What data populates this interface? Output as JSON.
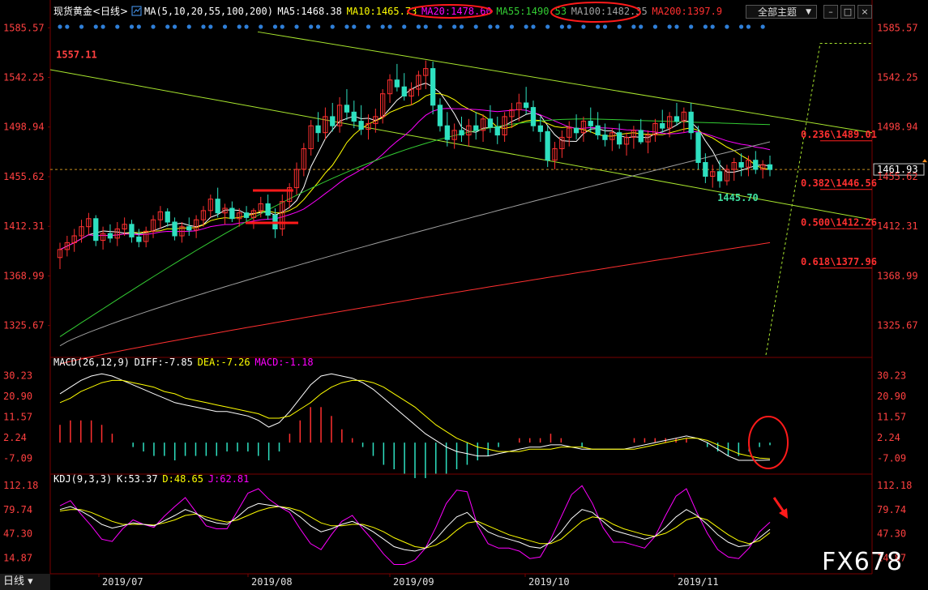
{
  "window": {
    "theme_button_label": "全部主题",
    "period_tab": "日线",
    "watermark": "FX678"
  },
  "price_panel": {
    "header": {
      "name": "现货黄金<日线>",
      "params": "MA(5,10,20,55,100,200)",
      "items": [
        {
          "text": "MA5:1468.38",
          "color": "#ffffff"
        },
        {
          "text": "MA10:1465.73",
          "color": "#ffff00"
        },
        {
          "text": "MA20:1478.60",
          "color": "#ff00ff"
        },
        {
          "text": "MA55:1490.53",
          "color": "#33cc33"
        },
        {
          "text": "MA100:1482.35",
          "color": "#a0a0a0"
        },
        {
          "text": "MA200:1397.9",
          "color": "#ff3030"
        }
      ]
    },
    "y_ticks": [
      "1585.57",
      "1542.25",
      "1498.94",
      "1455.62",
      "1412.31",
      "1368.99",
      "1325.67"
    ],
    "last_price": "1461.93",
    "high_label": "1557.11",
    "low_label": "1445.70",
    "fib_labels": [
      {
        "text": "0.236\\1489.01",
        "value": 1489.01
      },
      {
        "text": "0.382\\1446.56",
        "value": 1446.56
      },
      {
        "text": "0.500\\1412.26",
        "value": 1412.26
      },
      {
        "text": "0.618\\1377.96",
        "value": 1377.96
      }
    ]
  },
  "macd_panel": {
    "header": {
      "name": "MACD(26,12,9)",
      "items": [
        {
          "text": "DIFF:-7.85",
          "color": "#ffffff"
        },
        {
          "text": "DEA:-7.26",
          "color": "#ffff00"
        },
        {
          "text": "MACD:-1.18",
          "color": "#ff00ff"
        }
      ]
    },
    "y_ticks": [
      "30.23",
      "20.90",
      "11.57",
      "2.24",
      "-7.09"
    ]
  },
  "kdj_panel": {
    "header": {
      "name": "KDJ(9,3,3)",
      "items": [
        {
          "text": "K:53.37",
          "color": "#ffffff"
        },
        {
          "text": "D:48.65",
          "color": "#ffff00"
        },
        {
          "text": "J:62.81",
          "color": "#ff00ff"
        }
      ]
    },
    "y_ticks": [
      "112.18",
      "79.74",
      "47.30",
      "14.87"
    ]
  },
  "x_axis": {
    "labels": [
      "2019/07",
      "2019/08",
      "2019/09",
      "2019/10",
      "2019/11"
    ]
  },
  "colors": {
    "up": "#ff3030",
    "down": "#2ee0c0",
    "axis_text": "#ff4040",
    "grid": "#7a0000",
    "annotation": "#ff2020"
  },
  "chart_data": [
    {
      "type": "candlestick",
      "title": "现货黄金<日线>",
      "y_range": [
        1300,
        1590
      ],
      "x_labels": [
        "2019/07",
        "2019/08",
        "2019/09",
        "2019/10",
        "2019/11"
      ],
      "annotations": {
        "high": 1557.11,
        "low": 1445.7,
        "last": 1461.93
      },
      "ohlc": [
        [
          1385,
          1398,
          1375,
          1392
        ],
        [
          1392,
          1404,
          1386,
          1398
        ],
        [
          1398,
          1410,
          1390,
          1404
        ],
        [
          1404,
          1418,
          1398,
          1412
        ],
        [
          1412,
          1424,
          1405,
          1419
        ],
        [
          1419,
          1422,
          1395,
          1400
        ],
        [
          1400,
          1412,
          1392,
          1406
        ],
        [
          1406,
          1414,
          1398,
          1402
        ],
        [
          1402,
          1416,
          1395,
          1410
        ],
        [
          1410,
          1420,
          1404,
          1414
        ],
        [
          1414,
          1418,
          1398,
          1403
        ],
        [
          1403,
          1410,
          1394,
          1399
        ],
        [
          1399,
          1412,
          1394,
          1408
        ],
        [
          1408,
          1422,
          1402,
          1418
        ],
        [
          1418,
          1430,
          1410,
          1425
        ],
        [
          1425,
          1428,
          1412,
          1416
        ],
        [
          1416,
          1420,
          1400,
          1404
        ],
        [
          1404,
          1416,
          1398,
          1412
        ],
        [
          1412,
          1420,
          1404,
          1409
        ],
        [
          1409,
          1422,
          1402,
          1418
        ],
        [
          1418,
          1430,
          1412,
          1426
        ],
        [
          1426,
          1440,
          1420,
          1436
        ],
        [
          1436,
          1446,
          1420,
          1424
        ],
        [
          1424,
          1432,
          1414,
          1428
        ],
        [
          1428,
          1434,
          1416,
          1419
        ],
        [
          1419,
          1428,
          1412,
          1424
        ],
        [
          1424,
          1430,
          1416,
          1420
        ],
        [
          1420,
          1428,
          1410,
          1426
        ],
        [
          1426,
          1438,
          1420,
          1432
        ],
        [
          1432,
          1440,
          1418,
          1422
        ],
        [
          1422,
          1428,
          1402,
          1410
        ],
        [
          1410,
          1440,
          1404,
          1434
        ],
        [
          1434,
          1450,
          1428,
          1446
        ],
        [
          1446,
          1468,
          1440,
          1462
        ],
        [
          1462,
          1485,
          1456,
          1480
        ],
        [
          1480,
          1505,
          1474,
          1500
        ],
        [
          1500,
          1512,
          1486,
          1494
        ],
        [
          1494,
          1516,
          1488,
          1508
        ],
        [
          1508,
          1520,
          1495,
          1500
        ],
        [
          1500,
          1525,
          1494,
          1518
        ],
        [
          1518,
          1532,
          1505,
          1512
        ],
        [
          1512,
          1522,
          1498,
          1504
        ],
        [
          1504,
          1518,
          1492,
          1497
        ],
        [
          1497,
          1510,
          1488,
          1502
        ],
        [
          1502,
          1515,
          1494,
          1508
        ],
        [
          1508,
          1532,
          1502,
          1528
        ],
        [
          1528,
          1545,
          1520,
          1540
        ],
        [
          1540,
          1554,
          1530,
          1534
        ],
        [
          1534,
          1546,
          1522,
          1526
        ],
        [
          1526,
          1538,
          1518,
          1532
        ],
        [
          1532,
          1548,
          1526,
          1544
        ],
        [
          1544,
          1557,
          1532,
          1550
        ],
        [
          1550,
          1556,
          1510,
          1518
        ],
        [
          1518,
          1524,
          1495,
          1500
        ],
        [
          1500,
          1512,
          1482,
          1488
        ],
        [
          1488,
          1502,
          1480,
          1496
        ],
        [
          1496,
          1508,
          1486,
          1492
        ],
        [
          1492,
          1506,
          1482,
          1500
        ],
        [
          1500,
          1512,
          1488,
          1496
        ],
        [
          1496,
          1510,
          1486,
          1506
        ],
        [
          1506,
          1518,
          1494,
          1499
        ],
        [
          1499,
          1508,
          1484,
          1492
        ],
        [
          1492,
          1512,
          1486,
          1508
        ],
        [
          1508,
          1520,
          1498,
          1514
        ],
        [
          1514,
          1528,
          1504,
          1520
        ],
        [
          1520,
          1534,
          1510,
          1516
        ],
        [
          1516,
          1522,
          1495,
          1500
        ],
        [
          1500,
          1508,
          1486,
          1495
        ],
        [
          1495,
          1500,
          1464,
          1470
        ],
        [
          1470,
          1486,
          1462,
          1480
        ],
        [
          1480,
          1496,
          1472,
          1490
        ],
        [
          1490,
          1504,
          1482,
          1498
        ],
        [
          1498,
          1510,
          1488,
          1494
        ],
        [
          1494,
          1508,
          1486,
          1504
        ],
        [
          1504,
          1516,
          1494,
          1500
        ],
        [
          1500,
          1512,
          1488,
          1492
        ],
        [
          1492,
          1502,
          1482,
          1488
        ],
        [
          1488,
          1498,
          1478,
          1494
        ],
        [
          1494,
          1502,
          1480,
          1484
        ],
        [
          1484,
          1494,
          1474,
          1490
        ],
        [
          1490,
          1500,
          1480,
          1496
        ],
        [
          1496,
          1506,
          1484,
          1486
        ],
        [
          1486,
          1496,
          1476,
          1492
        ],
        [
          1492,
          1506,
          1486,
          1502
        ],
        [
          1502,
          1514,
          1494,
          1498
        ],
        [
          1498,
          1512,
          1490,
          1508
        ],
        [
          1508,
          1520,
          1500,
          1504
        ],
        [
          1504,
          1516,
          1494,
          1512
        ],
        [
          1512,
          1520,
          1488,
          1494
        ],
        [
          1494,
          1500,
          1462,
          1468
        ],
        [
          1468,
          1476,
          1450,
          1456
        ],
        [
          1456,
          1466,
          1446,
          1460
        ],
        [
          1460,
          1470,
          1446,
          1452
        ],
        [
          1452,
          1466,
          1448,
          1462
        ],
        [
          1462,
          1472,
          1452,
          1468
        ],
        [
          1468,
          1476,
          1456,
          1464
        ],
        [
          1464,
          1474,
          1456,
          1470
        ],
        [
          1470,
          1478,
          1458,
          1462
        ],
        [
          1462,
          1470,
          1454,
          1466
        ],
        [
          1466,
          1474,
          1456,
          1461.93
        ]
      ],
      "moving_averages": [
        {
          "name": "MA5",
          "last": 1468.38
        },
        {
          "name": "MA10",
          "last": 1465.73
        },
        {
          "name": "MA20",
          "last": 1478.6
        },
        {
          "name": "MA55",
          "last": 1490.53
        },
        {
          "name": "MA100",
          "last": 1482.35
        },
        {
          "name": "MA200",
          "last": 1397.9
        }
      ],
      "fibonacci": [
        {
          "ratio": 0.236,
          "value": 1489.01
        },
        {
          "ratio": 0.382,
          "value": 1446.56
        },
        {
          "ratio": 0.5,
          "value": 1412.26
        },
        {
          "ratio": 0.618,
          "value": 1377.96
        }
      ]
    },
    {
      "type": "macd",
      "title": "MACD(26,12,9)",
      "y_range": [
        -12,
        34
      ],
      "last": {
        "DIFF": -7.85,
        "DEA": -7.26,
        "MACD": -1.18
      },
      "diff": [
        22,
        25,
        28,
        30,
        31,
        30,
        28,
        26,
        24,
        22,
        20,
        18,
        17,
        16,
        15,
        14,
        14,
        13,
        12,
        10,
        7,
        9,
        14,
        20,
        26,
        30,
        31,
        30,
        29,
        27,
        24,
        20,
        16,
        12,
        8,
        4,
        1,
        -2,
        -4,
        -5,
        -6,
        -6,
        -5,
        -4,
        -3,
        -2,
        -2,
        -1,
        -1,
        -2,
        -3,
        -3,
        -3,
        -3,
        -3,
        -2,
        -1,
        0,
        1,
        2,
        3,
        2,
        0,
        -3,
        -6,
        -8,
        -8,
        -8,
        -7.85
      ],
      "dea": [
        18,
        20,
        23,
        25,
        27,
        28,
        28,
        27,
        26,
        25,
        23,
        22,
        20,
        19,
        18,
        17,
        16,
        15,
        14,
        13,
        11,
        11,
        12,
        15,
        18,
        22,
        25,
        27,
        28,
        28,
        27,
        25,
        22,
        19,
        16,
        12,
        8,
        5,
        2,
        0,
        -2,
        -3,
        -4,
        -4,
        -4,
        -3,
        -3,
        -3,
        -2,
        -2,
        -2,
        -3,
        -3,
        -3,
        -3,
        -3,
        -2,
        -1,
        0,
        1,
        2,
        2,
        1,
        -1,
        -3,
        -5,
        -6,
        -7,
        -7.26
      ],
      "hist": [
        8,
        10,
        10,
        10,
        8,
        4,
        0,
        -2,
        -4,
        -6,
        -6,
        -8,
        -6,
        -6,
        -6,
        -6,
        -4,
        -4,
        -4,
        -6,
        -8,
        -4,
        4,
        10,
        16,
        16,
        12,
        6,
        2,
        -2,
        -6,
        -10,
        -12,
        -14,
        -16,
        -16,
        -14,
        -14,
        -12,
        -10,
        -8,
        -6,
        -2,
        0,
        2,
        2,
        2,
        4,
        2,
        0,
        -2,
        0,
        0,
        0,
        0,
        2,
        2,
        2,
        2,
        2,
        2,
        0,
        -2,
        -4,
        -6,
        -6,
        -4,
        -2,
        -1.18
      ]
    },
    {
      "type": "kdj",
      "title": "KDJ(9,3,3)",
      "y_range": [
        0,
        120
      ],
      "last": {
        "K": 53.37,
        "D": 48.65,
        "J": 62.81
      },
      "k": [
        80,
        84,
        78,
        70,
        60,
        55,
        58,
        62,
        60,
        58,
        65,
        72,
        80,
        75,
        66,
        62,
        60,
        70,
        82,
        88,
        86,
        84,
        80,
        70,
        58,
        50,
        54,
        60,
        64,
        58,
        50,
        40,
        30,
        26,
        24,
        28,
        40,
        56,
        70,
        76,
        62,
        50,
        44,
        40,
        36,
        30,
        28,
        36,
        50,
        68,
        80,
        76,
        64,
        52,
        48,
        44,
        40,
        44,
        56,
        70,
        80,
        72,
        60,
        46,
        36,
        30,
        32,
        42,
        53.37
      ],
      "d": [
        78,
        80,
        80,
        76,
        70,
        64,
        60,
        60,
        60,
        59,
        62,
        66,
        72,
        74,
        70,
        66,
        63,
        66,
        72,
        78,
        82,
        84,
        82,
        78,
        70,
        62,
        58,
        58,
        60,
        60,
        56,
        50,
        42,
        36,
        30,
        28,
        32,
        40,
        52,
        62,
        64,
        58,
        52,
        46,
        42,
        38,
        34,
        34,
        40,
        52,
        64,
        70,
        68,
        60,
        54,
        50,
        46,
        44,
        48,
        56,
        66,
        70,
        66,
        56,
        46,
        38,
        34,
        38,
        48.65
      ],
      "j": [
        85,
        92,
        74,
        58,
        40,
        37,
        54,
        66,
        60,
        56,
        71,
        84,
        96,
        77,
        58,
        54,
        54,
        78,
        102,
        108,
        94,
        84,
        76,
        54,
        34,
        26,
        46,
        64,
        72,
        54,
        38,
        20,
        6,
        6,
        12,
        28,
        56,
        88,
        106,
        104,
        58,
        34,
        28,
        28,
        24,
        14,
        16,
        40,
        70,
        100,
        112,
        88,
        56,
        36,
        36,
        32,
        28,
        44,
        72,
        98,
        108,
        76,
        48,
        26,
        16,
        14,
        28,
        50,
        62.81
      ]
    }
  ]
}
